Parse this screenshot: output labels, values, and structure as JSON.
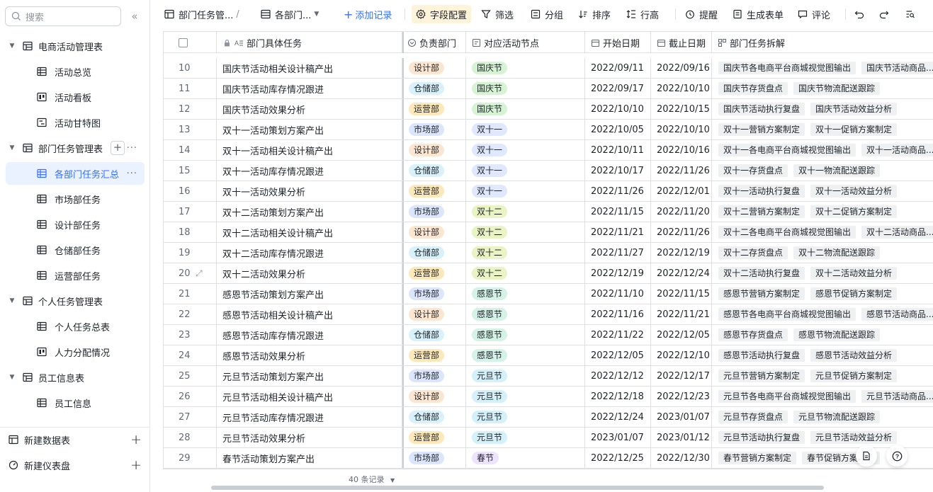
{
  "sidebar": {
    "search_placeholder": "搜索",
    "collapse": "«",
    "tree": [
      {
        "label": "电商活动管理表",
        "level": 0,
        "icon": "table-icon",
        "expanded": true
      },
      {
        "label": "活动总览",
        "level": 1,
        "icon": "grid-view-icon"
      },
      {
        "label": "活动看板",
        "level": 1,
        "icon": "kanban-icon"
      },
      {
        "label": "活动甘特图",
        "level": 1,
        "icon": "gantt-icon"
      },
      {
        "label": "部门任务管理表",
        "level": 0,
        "icon": "table-icon",
        "expanded": true
      },
      {
        "label": "各部门任务汇总",
        "level": 1,
        "icon": "grid-view-icon",
        "active": true
      },
      {
        "label": "市场部任务",
        "level": 1,
        "icon": "grid-view-icon"
      },
      {
        "label": "设计部任务",
        "level": 1,
        "icon": "grid-view-icon"
      },
      {
        "label": "仓储部任务",
        "level": 1,
        "icon": "grid-view-icon"
      },
      {
        "label": "运营部任务",
        "level": 1,
        "icon": "grid-view-icon"
      },
      {
        "label": "个人任务管理表",
        "level": 0,
        "icon": "table-icon",
        "expanded": true
      },
      {
        "label": "个人任务总表",
        "level": 1,
        "icon": "grid-view-icon"
      },
      {
        "label": "人力分配情况",
        "level": 1,
        "icon": "kanban-icon"
      },
      {
        "label": "员工信息表",
        "level": 0,
        "icon": "table-icon",
        "expanded": true
      },
      {
        "label": "员工信息",
        "level": 1,
        "icon": "grid-view-icon"
      }
    ],
    "bottom": {
      "new_table": "新建数据表",
      "new_dashboard": "新建仪表盘"
    }
  },
  "toolbar": {
    "table_name": "部门任务管...",
    "view_name": "各部门...",
    "add_record": "添加记录",
    "field_config": "字段配置",
    "filter": "筛选",
    "group": "分组",
    "sort": "排序",
    "row_height": "行高",
    "reminder": "提醒",
    "form": "生成表单",
    "comment": "评论"
  },
  "columns": {
    "task": "部门具体任务",
    "dept": "负责部门",
    "node": "对应活动节点",
    "start": "开始日期",
    "end": "截止日期",
    "sub": "部门任务拆解"
  },
  "colors": {
    "accent": "#3370ff",
    "dept": {
      "设计部": {
        "bg": "#fde6cf",
        "fg": "#1f2329"
      },
      "仓储部": {
        "bg": "#d8f1fb",
        "fg": "#1f2329"
      },
      "运营部": {
        "bg": "#fde8b8",
        "fg": "#1f2329"
      },
      "市场部": {
        "bg": "#dbe6fd",
        "fg": "#1f2329"
      }
    },
    "node": {
      "国庆节": {
        "bg": "#d6f4d4",
        "fg": "#1f2329"
      },
      "双十一": {
        "bg": "#dfe8fd",
        "fg": "#1f2329"
      },
      "双十二": {
        "bg": "#eaf3c4",
        "fg": "#1f2329"
      },
      "感恩节": {
        "bg": "#d4f2e6",
        "fg": "#1f2329"
      },
      "元旦节": {
        "bg": "#d4f1f9",
        "fg": "#1f2329"
      },
      "春节": {
        "bg": "#ece3fc",
        "fg": "#1f2329"
      }
    }
  },
  "rows": [
    {
      "no": "10",
      "task": "国庆节活动相关设计稿产出",
      "dept": "设计部",
      "node": "国庆节",
      "start": "2022/09/11",
      "end": "2022/09/16",
      "sub": [
        "国庆节各电商平台商城视觉图输出",
        "国庆节活动商品..."
      ]
    },
    {
      "no": "11",
      "task": "国庆节活动库存情况跟进",
      "dept": "仓储部",
      "node": "国庆节",
      "start": "2022/09/17",
      "end": "2022/10/10",
      "sub": [
        "国庆节存货盘点",
        "国庆节物流配送跟踪"
      ]
    },
    {
      "no": "12",
      "task": "国庆节活动效果分析",
      "dept": "运营部",
      "node": "国庆节",
      "start": "2022/10/10",
      "end": "2022/10/15",
      "sub": [
        "国庆节活动执行复盘",
        "国庆节活动效益分析"
      ]
    },
    {
      "no": "13",
      "task": "双十一活动策划方案产出",
      "dept": "市场部",
      "node": "双十一",
      "start": "2022/10/05",
      "end": "2022/10/10",
      "sub": [
        "双十一营销方案制定",
        "双十一促销方案制定"
      ]
    },
    {
      "no": "14",
      "task": "双十一活动相关设计稿产出",
      "dept": "设计部",
      "node": "双十一",
      "start": "2022/10/11",
      "end": "2022/10/16",
      "sub": [
        "双十一各电商平台商城视觉图输出",
        "双十一活动商品..."
      ]
    },
    {
      "no": "15",
      "task": "双十一活动库存情况跟进",
      "dept": "仓储部",
      "node": "双十一",
      "start": "2022/10/17",
      "end": "2022/11/26",
      "sub": [
        "双十一存货盘点",
        "双十一物流配送跟踪"
      ]
    },
    {
      "no": "16",
      "task": "双十一活动效果分析",
      "dept": "运营部",
      "node": "双十一",
      "start": "2022/11/26",
      "end": "2022/12/01",
      "sub": [
        "双十一活动执行复盘",
        "双十一活动效益分析"
      ]
    },
    {
      "no": "17",
      "task": "双十二活动策划方案产出",
      "dept": "市场部",
      "node": "双十二",
      "start": "2022/11/15",
      "end": "2022/11/20",
      "sub": [
        "双十二营销方案制定",
        "双十二促销方案制定"
      ]
    },
    {
      "no": "18",
      "task": "双十二活动相关设计稿产出",
      "dept": "设计部",
      "node": "双十二",
      "start": "2022/11/21",
      "end": "2022/11/26",
      "sub": [
        "双十二各电商平台商城视觉图输出",
        "双十二活动商品..."
      ]
    },
    {
      "no": "19",
      "task": "双十二活动库存情况跟进",
      "dept": "仓储部",
      "node": "双十二",
      "start": "2022/11/27",
      "end": "2022/12/19",
      "sub": [
        "双十二存货盘点",
        "双十二物流配送跟踪"
      ]
    },
    {
      "no": "20",
      "task": "双十二活动效果分析",
      "dept": "运营部",
      "node": "双十二",
      "start": "2022/12/19",
      "end": "2022/12/24",
      "sub": [
        "双十二活动执行复盘",
        "双十二活动效益分析"
      ],
      "hover": true
    },
    {
      "no": "21",
      "task": "感恩节活动策划方案产出",
      "dept": "市场部",
      "node": "感恩节",
      "start": "2022/11/10",
      "end": "2022/11/15",
      "sub": [
        "感恩节营销方案制定",
        "感恩节促销方案制定"
      ]
    },
    {
      "no": "22",
      "task": "感恩节活动相关设计稿产出",
      "dept": "设计部",
      "node": "感恩节",
      "start": "2022/11/16",
      "end": "2022/11/21",
      "sub": [
        "感恩节各电商平台商城视觉图输出",
        "感恩节活动商品..."
      ]
    },
    {
      "no": "23",
      "task": "感恩节活动库存情况跟进",
      "dept": "仓储部",
      "node": "感恩节",
      "start": "2022/11/22",
      "end": "2022/12/05",
      "sub": [
        "感恩节存货盘点",
        "感恩节物流配送跟踪"
      ]
    },
    {
      "no": "24",
      "task": "感恩节活动效果分析",
      "dept": "运营部",
      "node": "感恩节",
      "start": "2022/12/05",
      "end": "2022/12/10",
      "sub": [
        "感恩节活动执行复盘",
        "感恩节活动效益分析"
      ]
    },
    {
      "no": "25",
      "task": "元旦节活动策划方案产出",
      "dept": "市场部",
      "node": "元旦节",
      "start": "2022/12/12",
      "end": "2022/12/17",
      "sub": [
        "元旦节营销方案制定",
        "元旦节促销方案制定"
      ]
    },
    {
      "no": "26",
      "task": "元旦节活动相关设计稿产出",
      "dept": "设计部",
      "node": "元旦节",
      "start": "2022/12/18",
      "end": "2022/12/23",
      "sub": [
        "元旦节各电商平台商城视觉图输出",
        "元旦节活动商品..."
      ]
    },
    {
      "no": "27",
      "task": "元旦节活动库存情况跟进",
      "dept": "仓储部",
      "node": "元旦节",
      "start": "2022/12/24",
      "end": "2023/01/07",
      "sub": [
        "元旦节存货盘点",
        "元旦节物流配送跟踪"
      ]
    },
    {
      "no": "28",
      "task": "元旦节活动效果分析",
      "dept": "运营部",
      "node": "元旦节",
      "start": "2023/01/07",
      "end": "2023/01/12",
      "sub": [
        "元旦节活动执行复盘",
        "元旦节活动效益分析"
      ]
    },
    {
      "no": "29",
      "task": "春节活动策划方案产出",
      "dept": "市场部",
      "node": "春节",
      "start": "2022/12/25",
      "end": "2022/12/30",
      "sub": [
        "春节营销方案制定",
        "春节促销方案制定"
      ]
    }
  ],
  "footer": {
    "record_count": "40 条记录"
  }
}
